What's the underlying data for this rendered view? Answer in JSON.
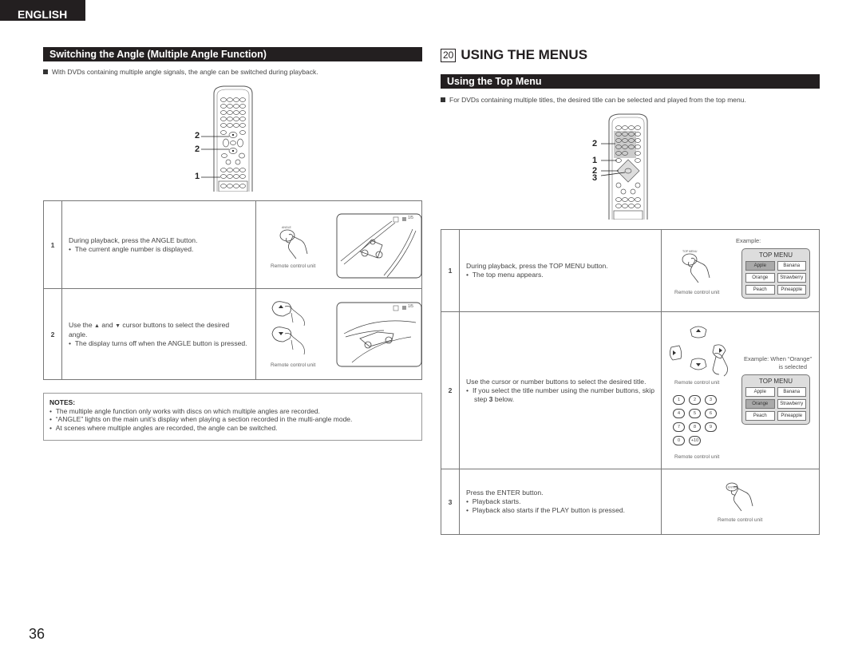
{
  "language_tab": "ENGLISH",
  "page_number": "36",
  "left_section": {
    "title": "Switching the Angle (Multiple Angle Function)",
    "intro": "With DVDs containing multiple angle signals, the angle can be switched during playback.",
    "remote_callouts": [
      "2",
      "2",
      "1"
    ],
    "steps": [
      {
        "number": "1",
        "text": "During playback, press the ANGLE button.",
        "bullets": [
          "The current angle number is displayed."
        ],
        "button_label": "ANGLE",
        "caption": "Remote control unit",
        "osd_text": "1/5"
      },
      {
        "number": "2",
        "text_pre": "Use the",
        "text_and": "and",
        "text_post": "cursor buttons to select the desired angle.",
        "up_symbol": "▲",
        "down_symbol": "▼",
        "bullets": [
          "The display turns off when the ANGLE button is pressed."
        ],
        "caption": "Remote control unit",
        "osd_text": "1/5"
      }
    ],
    "notes": {
      "heading": "NOTES:",
      "items": [
        "The multiple angle function only works with discs on which multiple angles are recorded.",
        "“ANGLE” lights on the main unit’s display when playing a section recorded in the multi-angle mode.",
        "At scenes where multiple angles are recorded, the angle can be switched."
      ]
    }
  },
  "right_section": {
    "chapter_number": "20",
    "chapter_title": "USING THE MENUS",
    "title": "Using the Top Menu",
    "intro": "For DVDs containing multiple titles, the desired title can be selected and played from the top menu.",
    "remote_callouts": [
      "2",
      "1",
      "2",
      "3"
    ],
    "steps": [
      {
        "number": "1",
        "text": "During playback, press the TOP MENU button.",
        "bullets": [
          "The top menu appears."
        ],
        "button_label": "TOP MENU",
        "caption": "Remote control unit",
        "example_label": "Example:",
        "menu": {
          "title": "TOP MENU",
          "items": [
            "Apple",
            "Banana",
            "Orange",
            "Strawberry",
            "Peach",
            "Pineapple"
          ],
          "selected": "Apple"
        }
      },
      {
        "number": "2",
        "text": "Use the cursor or number buttons to select the desired title.",
        "bullets_pre": "If you select the title number using the number buttons, skip step",
        "bullets_bold": "3",
        "bullets_post": "below.",
        "caption_cursor": "Remote control unit",
        "caption_numbers": "Remote control unit",
        "number_keys": [
          "1",
          "2",
          "3",
          "4",
          "5",
          "6",
          "7",
          "8",
          "9",
          "0",
          "+10"
        ],
        "example_label_line1": "Example: When “Orange”",
        "example_label_line2": "is selected",
        "menu": {
          "title": "TOP MENU",
          "items": [
            "Apple",
            "Banana",
            "Orange",
            "Strawberry",
            "Peach",
            "Pineapple"
          ],
          "selected": "Orange"
        }
      },
      {
        "number": "3",
        "text": "Press the ENTER button.",
        "bullets": [
          "Playback starts.",
          "Playback also starts if the PLAY button is pressed."
        ],
        "button_label": "ENTER",
        "caption": "Remote control unit"
      }
    ]
  }
}
